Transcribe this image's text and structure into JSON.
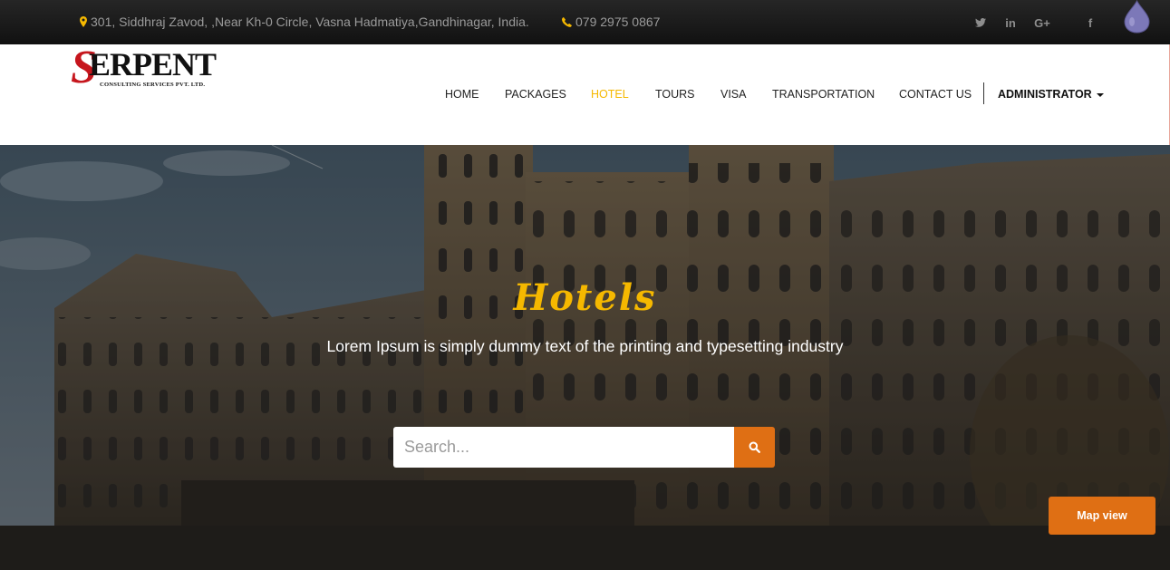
{
  "topbar": {
    "address": "301, Siddhraj Zavod, ,Near Kh-0 Circle, Vasna Hadmatiya,Gandhinagar, India.",
    "phone": "079 2975 0867",
    "social": [
      "twitter-icon",
      "linkedin-icon",
      "google-plus-icon",
      "facebook-icon"
    ],
    "social_glyphs": {
      "twitter": "t",
      "linkedin": "in",
      "google_plus": "G+",
      "facebook": "f"
    }
  },
  "logo": {
    "letter": "S",
    "name": "ERPENT",
    "tagline": "CONSULTING SERVICES PVT. LTD."
  },
  "nav": {
    "items": [
      "HOME",
      "PACKAGES",
      "HOTEL",
      "TOURS",
      "VISA",
      "TRANSPORTATION",
      "CONTACT US"
    ],
    "active": "HOTEL",
    "user_menu": "ADMINISTRATOR"
  },
  "hero": {
    "title": "Hotels",
    "subtitle": "Lorem Ipsum is simply dummy text of the printing and typesetting industry",
    "search_placeholder": "Search...",
    "map_button": "Map view"
  },
  "colors": {
    "accent_yellow": "#f5b800",
    "accent_orange": "#df6f14",
    "logo_red": "#c6161d",
    "topbar_bg": "#1a1a1a"
  }
}
